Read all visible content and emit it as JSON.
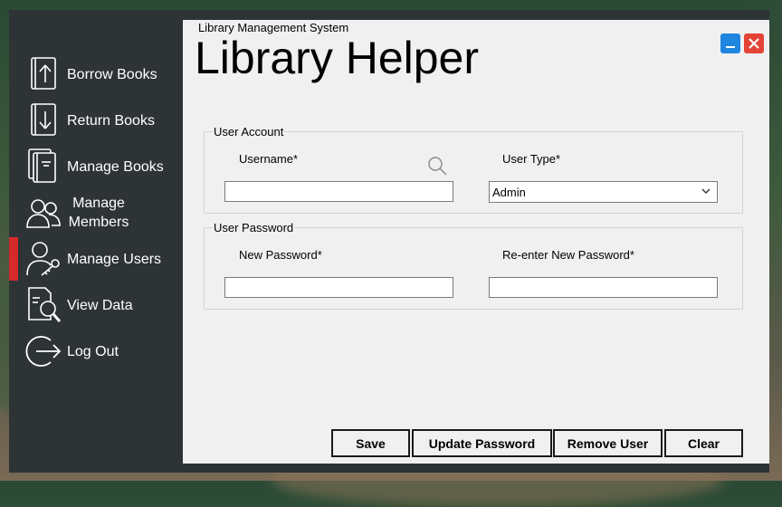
{
  "window": {
    "subtitle": "Library  Management System",
    "title": "Library Helper"
  },
  "sidebar": {
    "active_index": 4,
    "active_color": "#d42a2a",
    "items": [
      {
        "label": "Borrow Books",
        "icon": "borrow-book-icon"
      },
      {
        "label": "Return Books",
        "icon": "return-book-icon"
      },
      {
        "label": "Manage Books",
        "icon": "books-stack-icon"
      },
      {
        "label": "Manage Members",
        "icon": "members-icon"
      },
      {
        "label": "Manage Users",
        "icon": "user-key-icon"
      },
      {
        "label": "View Data",
        "icon": "document-search-icon"
      },
      {
        "label": "Log Out",
        "icon": "logout-icon"
      }
    ]
  },
  "user_account": {
    "group_title": "User Account",
    "username_label": "Username*",
    "username_value": "",
    "user_type_label": "User Type*",
    "user_type_value": "Admin"
  },
  "user_password": {
    "group_title": "User Password",
    "new_password_label": "New Password*",
    "new_password_value": "",
    "reenter_password_label": "Re-enter New Password*",
    "reenter_password_value": ""
  },
  "buttons": {
    "save": "Save",
    "update_password": "Update Password",
    "remove_user": "Remove User",
    "clear": "Clear"
  },
  "colors": {
    "sidebar_bg": "#2e3436",
    "minimize": "#1f86e0",
    "close": "#e54335"
  }
}
